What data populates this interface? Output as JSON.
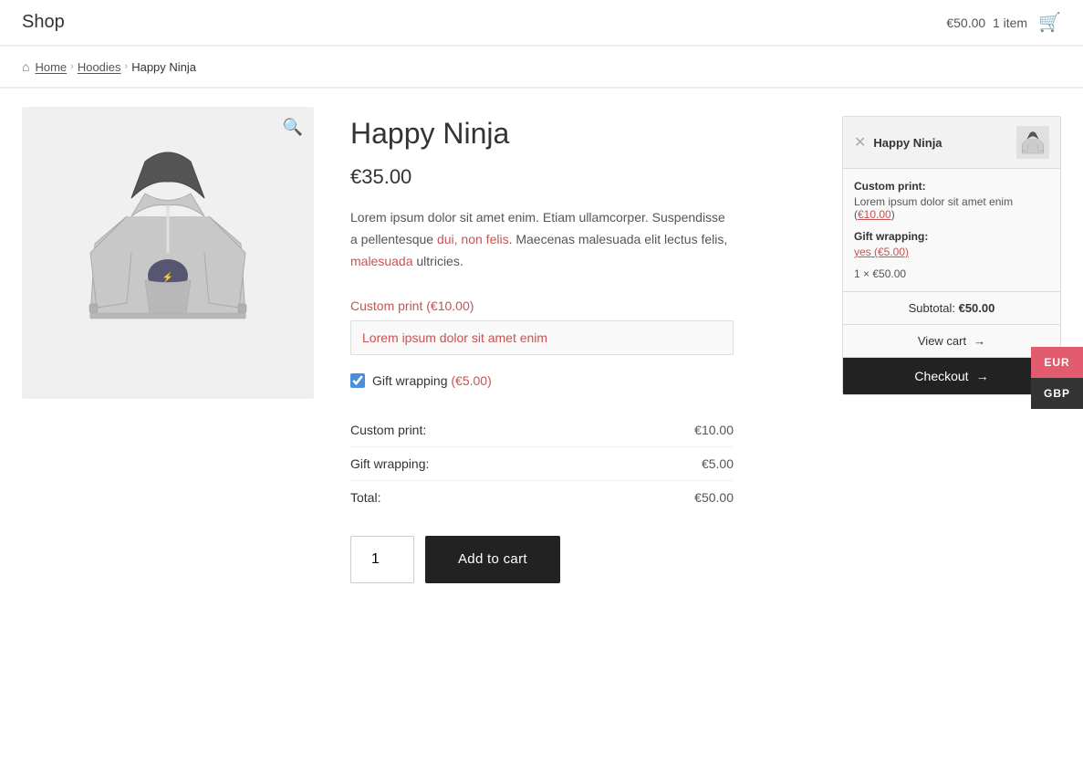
{
  "header": {
    "logo": "Shop",
    "cart_amount": "€50.00",
    "cart_count": "1 item",
    "cart_icon": "🛒"
  },
  "breadcrumb": {
    "home": "Home",
    "category": "Hoodies",
    "current": "Happy Ninja",
    "home_icon": "⌂"
  },
  "product": {
    "title": "Happy Ninja",
    "price": "€35.00",
    "description_parts": [
      "Lorem ipsum dolor sit amet enim. Etiam ullamcorper. Suspendisse a pellentesque ",
      "dui, non felis",
      ". Maecenas malesuada elit lectus felis, ",
      "malesuada",
      " ultricies."
    ],
    "description_text": "Lorem ipsum dolor sit amet enim. Etiam ullamcorper. Suspendisse a pellentesque dui, non felis. Maecenas malesuada elit lectus felis, malesuada ultricies.",
    "custom_print_label": "Custom print (€10.00)",
    "custom_print_placeholder": "Lorem ipsum dolor sit amet enim",
    "custom_print_value": "Lorem ipsum dolor sit amet enim",
    "gift_wrapping_label": "Gift wrapping (€5.00)",
    "gift_wrapping_amount": "€5.00",
    "gift_wrapping_checked": true,
    "pricing": [
      {
        "label": "Custom print:",
        "value": "€10.00"
      },
      {
        "label": "Gift wrapping:",
        "value": "€5.00"
      },
      {
        "label": "Total:",
        "value": "€50.00"
      }
    ],
    "quantity": "1",
    "add_to_cart": "Add to cart",
    "zoom_icon": "🔍"
  },
  "cart_widget": {
    "product_name": "Happy Ninja",
    "remove_icon": "✕",
    "custom_print_label": "Custom print:",
    "custom_print_value": "Lorem ipsum dolor sit amet enim (€10.00)",
    "gift_wrapping_label": "Gift wrapping:",
    "gift_wrapping_value": "yes (€5.00)",
    "qty_price": "1 × €50.00",
    "subtotal_label": "Subtotal:",
    "subtotal_value": "€50.00",
    "view_cart": "View cart",
    "checkout": "Checkout",
    "arrow": "→"
  },
  "currency": {
    "eur": "EUR",
    "gbp": "GBP"
  }
}
